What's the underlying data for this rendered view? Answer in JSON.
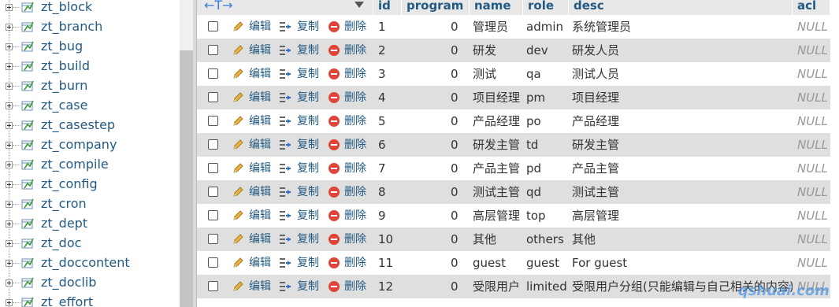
{
  "sidebar": {
    "tables": [
      "zt_block",
      "zt_branch",
      "zt_bug",
      "zt_build",
      "zt_burn",
      "zt_case",
      "zt_casestep",
      "zt_company",
      "zt_compile",
      "zt_config",
      "zt_cron",
      "zt_dept",
      "zt_doc",
      "zt_doccontent",
      "zt_doclib",
      "zt_effort"
    ]
  },
  "table": {
    "nav_arrows": "←T→",
    "columns": {
      "id": "id",
      "program": "program",
      "name": "name",
      "role": "role",
      "desc": "desc",
      "acl": "acl"
    },
    "actions": {
      "edit": "编辑",
      "copy": "复制",
      "delete": "删除"
    },
    "rows": [
      {
        "id": "1",
        "program": "0",
        "name": "管理员",
        "role": "admin",
        "desc": "系统管理员",
        "acl": "NULL"
      },
      {
        "id": "2",
        "program": "0",
        "name": "研发",
        "role": "dev",
        "desc": "研发人员",
        "acl": "NULL"
      },
      {
        "id": "3",
        "program": "0",
        "name": "测试",
        "role": "qa",
        "desc": "测试人员",
        "acl": "NULL"
      },
      {
        "id": "4",
        "program": "0",
        "name": "项目经理",
        "role": "pm",
        "desc": "项目经理",
        "acl": "NULL"
      },
      {
        "id": "5",
        "program": "0",
        "name": "产品经理",
        "role": "po",
        "desc": "产品经理",
        "acl": "NULL"
      },
      {
        "id": "6",
        "program": "0",
        "name": "研发主管",
        "role": "td",
        "desc": "研发主管",
        "acl": "NULL"
      },
      {
        "id": "7",
        "program": "0",
        "name": "产品主管",
        "role": "pd",
        "desc": "产品主管",
        "acl": "NULL"
      },
      {
        "id": "8",
        "program": "0",
        "name": "测试主管",
        "role": "qd",
        "desc": "测试主管",
        "acl": "NULL"
      },
      {
        "id": "9",
        "program": "0",
        "name": "高层管理",
        "role": "top",
        "desc": "高层管理",
        "acl": "NULL"
      },
      {
        "id": "10",
        "program": "0",
        "name": "其他",
        "role": "others",
        "desc": "其他",
        "acl": "NULL"
      },
      {
        "id": "11",
        "program": "0",
        "name": "guest",
        "role": "guest",
        "desc": "For guest",
        "acl": "NULL"
      },
      {
        "id": "12",
        "program": "0",
        "name": "受限用户",
        "role": "limited",
        "desc": "受限用户分组(只能编辑与自己相关的内容)",
        "acl": "NULL"
      }
    ]
  },
  "watermark": "qshuai.com",
  "colors": {
    "link": "#235a81",
    "row_even": "#dfdfdf",
    "header_bg": "#e8e8e8",
    "delete_red": "#e0453a"
  }
}
